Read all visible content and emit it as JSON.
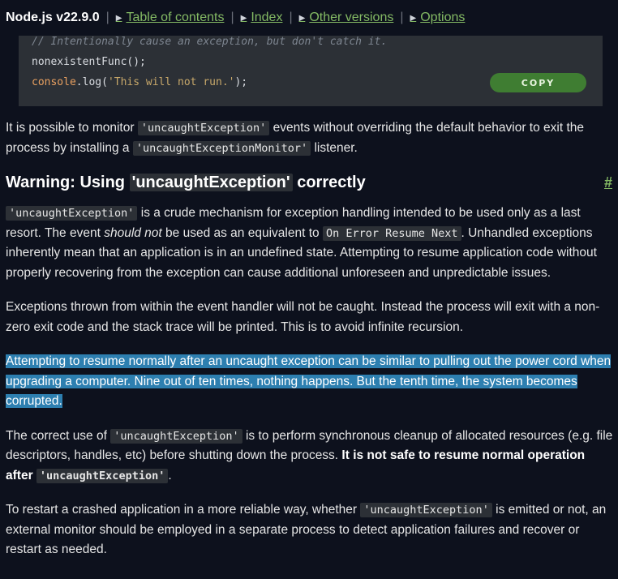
{
  "header": {
    "title": "Node.js v22.9.0",
    "links": [
      "Table of contents",
      "Index",
      "Other versions",
      "Options"
    ]
  },
  "code_block": {
    "line1": "// Intentionally cause an exception, but don't catch it.",
    "line2": "nonexistentFunc();",
    "line3_obj": "console",
    "line3_mid": ".log(",
    "line3_str": "'This will not run.'",
    "line3_end": ");",
    "copy_label": "COPY"
  },
  "section": {
    "p_monitor": {
      "t1": "It is possible to monitor ",
      "c1": "'uncaughtException'",
      "t2": " events without overriding the default behavior to exit the process by installing a ",
      "c2": "'uncaughtExceptionMonitor'",
      "t3": " listener."
    },
    "heading": {
      "prefix": "Warning: Using ",
      "code": "'uncaughtException'",
      "suffix": " correctly",
      "anchor": "#"
    },
    "p1": {
      "c1": "'uncaughtException'",
      "t1": " is a crude mechanism for exception handling intended to be used only as a last resort. The event ",
      "em": "should not",
      "t2": " be used as an equivalent to ",
      "c2": "On Error Resume Next",
      "t3": ". Unhandled exceptions inherently mean that an application is in an undefined state. Attempting to resume application code without properly recovering from the exception can cause additional unforeseen and unpredictable issues."
    },
    "p2": "Exceptions thrown from within the event handler will not be caught. Instead the process will exit with a non-zero exit code and the stack trace will be printed. This is to avoid infinite recursion.",
    "p3": "Attempting to resume normally after an uncaught exception can be similar to pulling out the power cord when upgrading a computer. Nine out of ten times, nothing happens. But the tenth time, the system becomes corrupted.",
    "p4": {
      "t1": "The correct use of ",
      "c1": "'uncaughtException'",
      "t2": " is to perform synchronous cleanup of allocated resources (e.g. file descriptors, handles, etc) before shutting down the process. ",
      "strong": "It is not safe to resume normal operation after ",
      "c2": "'uncaughtException'",
      "t3": "."
    },
    "p5": {
      "t1": "To restart a crashed application in a more reliable way, whether ",
      "c1": "'uncaughtException'",
      "t2": " is emitted or not, an external monitor should be employed in a separate process to detect application failures and recover or restart as needed."
    }
  }
}
